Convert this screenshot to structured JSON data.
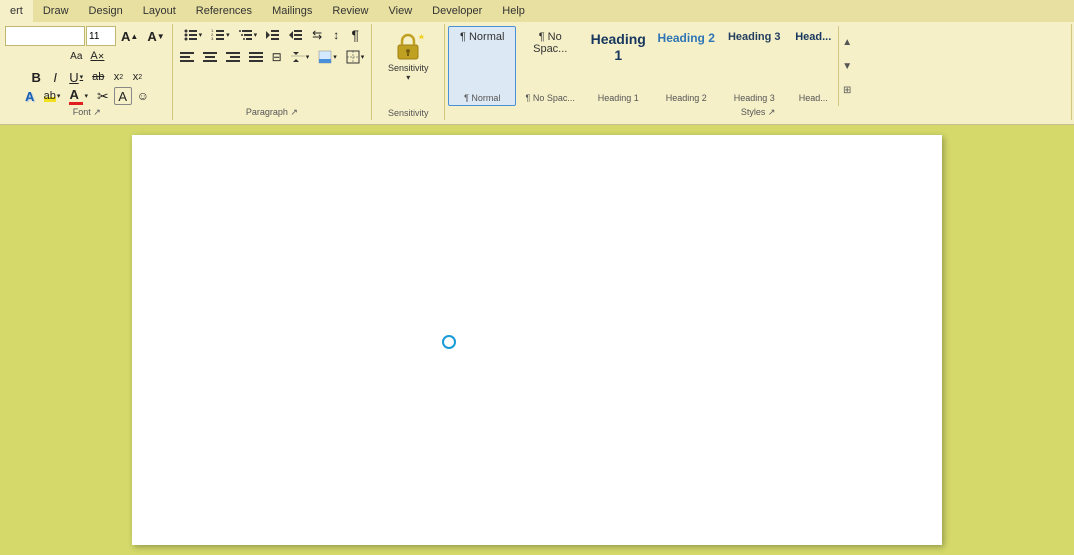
{
  "tabs": [
    {
      "label": "ert",
      "active": false
    },
    {
      "label": "Draw",
      "active": false
    },
    {
      "label": "Design",
      "active": false
    },
    {
      "label": "Layout",
      "active": false
    },
    {
      "label": "References",
      "active": false
    },
    {
      "label": "Mailings",
      "active": false
    },
    {
      "label": "Review",
      "active": false
    },
    {
      "label": "View",
      "active": false
    },
    {
      "label": "Developer",
      "active": false
    },
    {
      "label": "Help",
      "active": false
    }
  ],
  "font_group": {
    "label": "Font",
    "font_name": "",
    "font_size": "11",
    "grow_label": "A",
    "shrink_label": "A",
    "case_label": "Aa",
    "format_painter": "🖌",
    "clear_label": "A",
    "bold": "B",
    "italic": "I",
    "underline": "U",
    "strikethrough": "ab",
    "subscript": "x",
    "superscript": "x",
    "text_effects": "A",
    "highlight": "ab",
    "font_color": "A"
  },
  "paragraph_group": {
    "label": "Paragraph",
    "bullets": "≡",
    "numbering": "≡",
    "multilevel": "≡",
    "decrease_indent": "⇐",
    "increase_indent": "⇒",
    "sort": "↕",
    "show_marks": "¶",
    "align_left": "≡",
    "align_center": "≡",
    "align_right": "≡",
    "justify": "≡",
    "columns": "⊞",
    "line_spacing": "↕",
    "shading": "A",
    "borders": "⊞"
  },
  "sensitivity_group": {
    "label": "Sensitivity",
    "icon": "🔒",
    "dropdown": "▾"
  },
  "styles_group": {
    "label": "Styles",
    "items": [
      {
        "id": "normal",
        "preview_text": "¶ Normal",
        "label": "¶ Normal",
        "selected": true
      },
      {
        "id": "no-spacing",
        "preview_text": "¶ No Spac...",
        "label": "¶ No Spac...",
        "selected": false
      },
      {
        "id": "heading1",
        "preview_text": "Heading 1",
        "label": "Heading 1",
        "selected": false
      },
      {
        "id": "heading2",
        "preview_text": "Heading 2",
        "label": "Heading 2",
        "selected": false
      },
      {
        "id": "heading3",
        "preview_text": "Heading 3",
        "label": "Heading 3",
        "selected": false
      },
      {
        "id": "heading4",
        "preview_text": "Head...",
        "label": "Head...",
        "selected": false
      }
    ]
  },
  "doc": {
    "background": "#ffffff",
    "cursor_visible": true
  }
}
